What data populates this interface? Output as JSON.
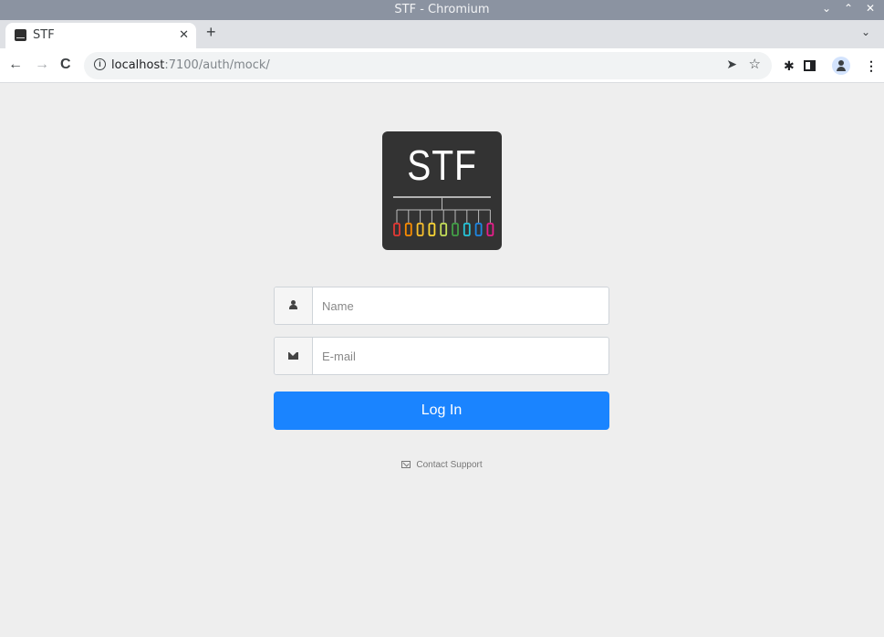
{
  "window": {
    "title": "STF - Chromium",
    "controls": [
      "⌄",
      "⌃",
      "✕"
    ]
  },
  "tab": {
    "title": "STF",
    "close": "✕",
    "new_tab": "+",
    "tab_menu": "⌄"
  },
  "toolbar": {
    "back": "←",
    "forward": "→",
    "reload": "C",
    "url_host": "localhost",
    "url_path": ":7100/auth/mock/",
    "send_glyph": "➤",
    "star_glyph": "☆",
    "extensions_glyph": "✱",
    "menu_glyph": "⋮"
  },
  "logo": {
    "text": "STF",
    "port_colors": [
      "#e53935",
      "#fb8c00",
      "#fbc02d",
      "#fdd835",
      "#c6e05a",
      "#43a047",
      "#26c6da",
      "#1e88e5",
      "#e91e8c"
    ]
  },
  "form": {
    "name_placeholder": "Name",
    "email_placeholder": "E-mail",
    "name_value": "",
    "email_value": "",
    "login_label": "Log In"
  },
  "support": {
    "label": "Contact Support"
  }
}
